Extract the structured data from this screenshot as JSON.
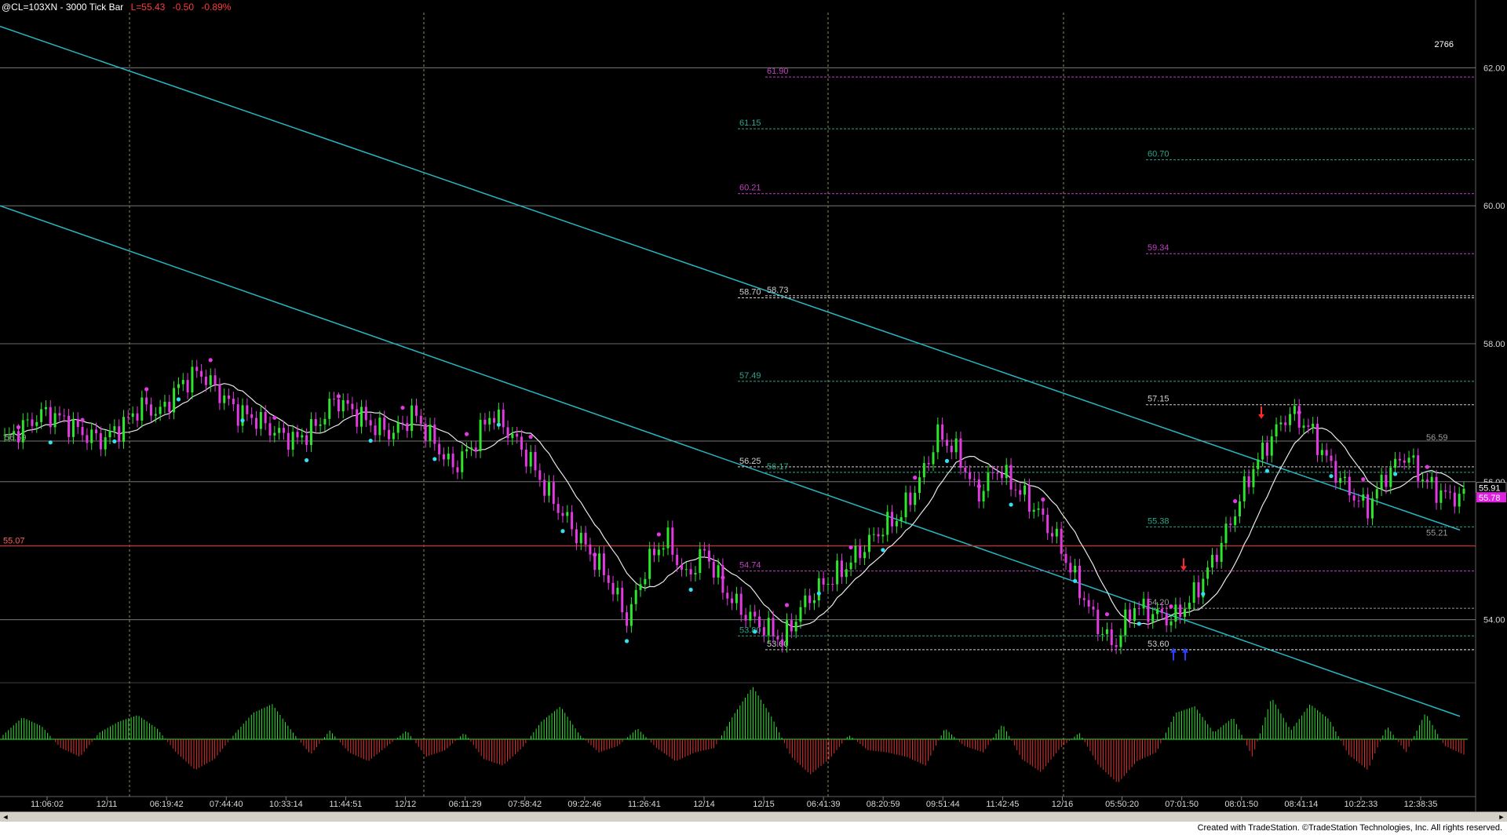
{
  "header": {
    "symbol": "@CL=103XN - 3000 Tick Bar",
    "last": "L=55.43",
    "change": "-0.50",
    "percent": "-0.89%"
  },
  "footer": {
    "text": "Created with TradeStation. ©TradeStation Technologies, Inc. All rights reserved."
  },
  "scroll": {
    "left_arrow": "◄",
    "right_arrow": "►"
  },
  "colors": {
    "up_bar": "#2ee52e",
    "down_bar": "#e03ae0",
    "channel": "#27b7c4",
    "ma": "#e8e8e8",
    "fib_magenta": "#c040c0",
    "fib_green": "#2aa58a",
    "level_white": "#cfcfcf",
    "hist_up": "#2ee52e",
    "hist_down": "#e33030",
    "last_price_bg": "#e020e0",
    "red_line": "#c83030"
  },
  "chart_data": {
    "type": "line",
    "title": "@CL=103XN - 3000 Tick Bar",
    "ylim": [
      53.2,
      62.8
    ],
    "price_axis_labels": [
      "62.00",
      "60.00",
      "58.00",
      "56.00",
      "54.00"
    ],
    "price_axis_values": [
      62,
      60,
      58,
      56,
      54
    ],
    "last_price_labels": [
      "55.91",
      "55.78"
    ],
    "time_axis_labels": [
      "11:06:02",
      "12/11",
      "06:19:42",
      "07:44:40",
      "10:33:14",
      "11:44:51",
      "12/12",
      "06:11:29",
      "07:58:42",
      "09:22:46",
      "11:26:41",
      "12/14",
      "12/15",
      "06:41:39",
      "08:20:59",
      "09:51:44",
      "11:42:45",
      "12/16",
      "05:50:20",
      "07:01:50",
      "08:01:50",
      "08:41:14",
      "10:22:33",
      "12:38:35"
    ],
    "bar_count_label": "2766",
    "price_series_approx": [
      56.6,
      56.8,
      57.0,
      56.9,
      56.7,
      56.6,
      56.8,
      57.1,
      57.0,
      57.4,
      57.6,
      57.3,
      57.0,
      56.9,
      56.7,
      56.6,
      56.8,
      57.2,
      57.0,
      56.8,
      56.7,
      57.0,
      56.6,
      56.2,
      56.5,
      57.0,
      56.7,
      56.3,
      55.8,
      55.4,
      55.0,
      54.6,
      54.0,
      54.8,
      55.2,
      54.6,
      55.0,
      54.4,
      54.1,
      53.9,
      53.7,
      54.2,
      54.5,
      54.7,
      55.0,
      55.3,
      55.5,
      56.0,
      56.7,
      56.4,
      55.8,
      56.2,
      55.9,
      55.6,
      55.2,
      54.6,
      54.0,
      53.6,
      54.2,
      54.1,
      54.0,
      54.3,
      54.8,
      55.4,
      56.1,
      56.6,
      57.0,
      56.8,
      56.3,
      55.9,
      55.6,
      56.1,
      56.4,
      56.0,
      55.8,
      55.78
    ],
    "annotations": [
      {
        "label": "61.90",
        "value": 61.9,
        "color": "magenta"
      },
      {
        "label": "61.15",
        "value": 61.15,
        "color": "green"
      },
      {
        "label": "60.70",
        "value": 60.7,
        "color": "green"
      },
      {
        "label": "60.21",
        "value": 60.21,
        "color": "magenta"
      },
      {
        "label": "59.34",
        "value": 59.34,
        "color": "magenta"
      },
      {
        "label": "58.70",
        "value": 58.7,
        "color": "white"
      },
      {
        "label": "58.73",
        "value": 58.73,
        "color": "white"
      },
      {
        "label": "57.49",
        "value": 57.49,
        "color": "green"
      },
      {
        "label": "57.15",
        "value": 57.15,
        "color": "white"
      },
      {
        "label": "56.59",
        "value": 56.59,
        "color": "gray"
      },
      {
        "label": "56.59",
        "value": 56.59,
        "color": "gray"
      },
      {
        "label": "56.25",
        "value": 56.25,
        "color": "white"
      },
      {
        "label": "56.17",
        "value": 56.17,
        "color": "green"
      },
      {
        "label": "55.38",
        "value": 55.38,
        "color": "green"
      },
      {
        "label": "55.21",
        "value": 55.21,
        "color": "gray"
      },
      {
        "label": "55.07",
        "value": 55.07,
        "color": "red"
      },
      {
        "label": "54.74",
        "value": 54.74,
        "color": "magenta"
      },
      {
        "label": "54.20",
        "value": 54.2,
        "color": "gray"
      },
      {
        "label": "53.80",
        "value": 53.8,
        "color": "green"
      },
      {
        "label": "53.60",
        "value": 53.6,
        "color": "white"
      },
      {
        "label": "53.60",
        "value": 53.6,
        "color": "white"
      }
    ],
    "oscillator_approx": [
      0.2,
      1.0,
      0.6,
      -0.4,
      -0.8,
      0.3,
      0.8,
      1.1,
      0.5,
      -0.6,
      -1.4,
      -0.9,
      0.2,
      1.2,
      1.6,
      0.4,
      -0.7,
      0.4,
      -0.6,
      -1.0,
      -0.3,
      0.4,
      -0.8,
      -0.5,
      0.3,
      -0.9,
      -1.2,
      -0.4,
      0.8,
      1.5,
      0.2,
      -0.6,
      -0.3,
      0.5,
      -0.4,
      -1.0,
      -0.6,
      -0.4,
      1.1,
      2.4,
      1.0,
      -0.8,
      -1.6,
      -0.9,
      0.2,
      -0.5,
      -0.6,
      -0.8,
      -1.2,
      0.5,
      -0.3,
      -0.6,
      0.7,
      -0.9,
      -1.5,
      -0.4,
      0.3,
      -1.2,
      -2.0,
      -1.0,
      -0.6,
      1.2,
      1.5,
      0.3,
      1.0,
      -0.8,
      1.9,
      0.4,
      1.6,
      0.9,
      -0.7,
      -1.4,
      0.6,
      -0.6,
      1.2,
      -0.3,
      -0.7
    ]
  }
}
